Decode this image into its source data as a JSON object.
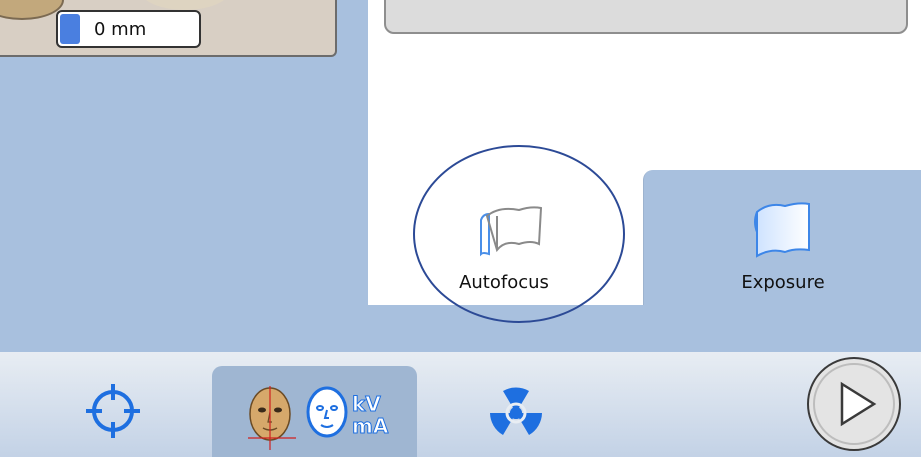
{
  "image_panel": {
    "depth_value": "0 mm"
  },
  "tabs": [
    {
      "label": "Autofocus",
      "active": true
    },
    {
      "label": "Exposure",
      "active": false
    }
  ],
  "bottom_bar": {
    "kv_label": "kV",
    "ma_label": "mA",
    "icons": [
      "target-icon",
      "patient-head-icon",
      "radiation-icon",
      "play-icon"
    ]
  },
  "colors": {
    "accent_blue": "#4a7fe0",
    "panel_blue": "#a8c0de",
    "annotation_circle": "#2c4a96"
  }
}
